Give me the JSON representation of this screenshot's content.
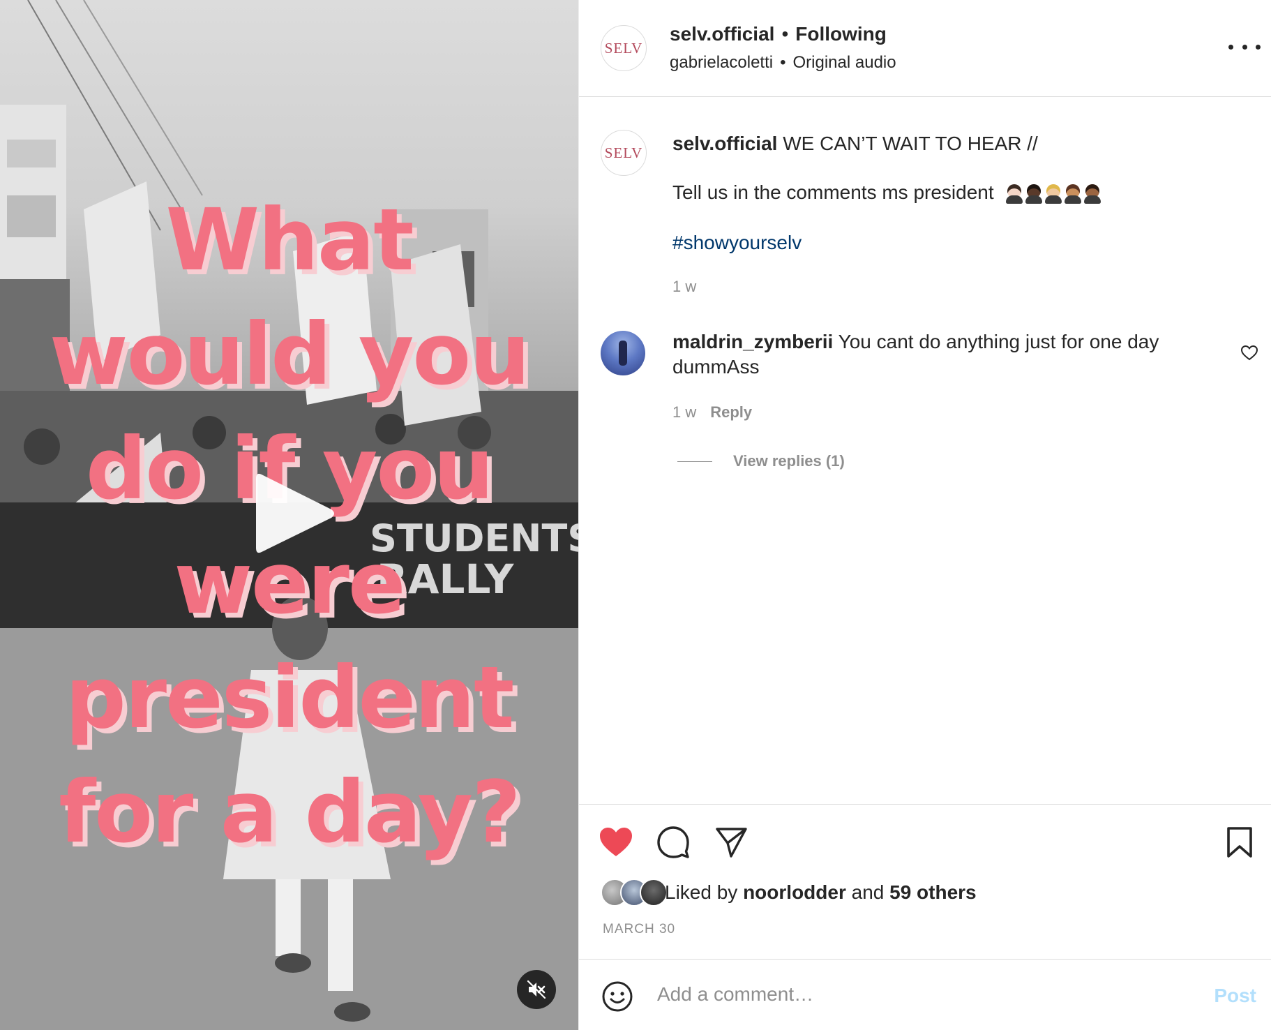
{
  "video": {
    "overlay_lines": [
      "What",
      "would you",
      "do if you",
      "were",
      "president",
      "for a day?"
    ],
    "overlay_color": "#f27182",
    "icons": {
      "play": "play-icon",
      "mute": "muted-speaker-icon"
    }
  },
  "header": {
    "avatar_label": "SELV",
    "username": "selv.official",
    "separator": "•",
    "follow_status": "Following",
    "audio_author": "gabrielacoletti",
    "audio_name": "Original audio",
    "more_icon": "more-options-icon"
  },
  "caption": {
    "avatar_label": "SELV",
    "username": "selv.official",
    "text": "WE CAN’T WAIT TO HEAR //",
    "line2": "Tell us in the comments ms president",
    "emojis": [
      "woman-office-worker-light",
      "woman-office-worker-dark",
      "woman-office-worker-medium-light",
      "woman-office-worker-medium",
      "woman-office-worker-medium-dark"
    ],
    "hashtag": "#showyourselv",
    "time": "1 w"
  },
  "comment": {
    "username": "maldrin_zymberii",
    "text": "You cant do anything just for one day dummAss",
    "time": "1 w",
    "reply_label": "Reply",
    "view_replies": "View replies (1)",
    "like_icon": "heart-outline-icon"
  },
  "actions": {
    "like_icon": "heart-filled-icon",
    "like_color": "#ed4956",
    "comment_icon": "comment-bubble-icon",
    "share_icon": "paper-plane-icon",
    "save_icon": "bookmark-icon",
    "liked_by_prefix": "Liked by",
    "liked_by_user": "noorlodder",
    "liked_by_and": "and",
    "liked_by_others": "59 others",
    "date": "MARCH 30"
  },
  "comment_box": {
    "emoji_icon": "smiley-icon",
    "placeholder": "Add a comment…",
    "value": "",
    "post_label": "Post"
  }
}
